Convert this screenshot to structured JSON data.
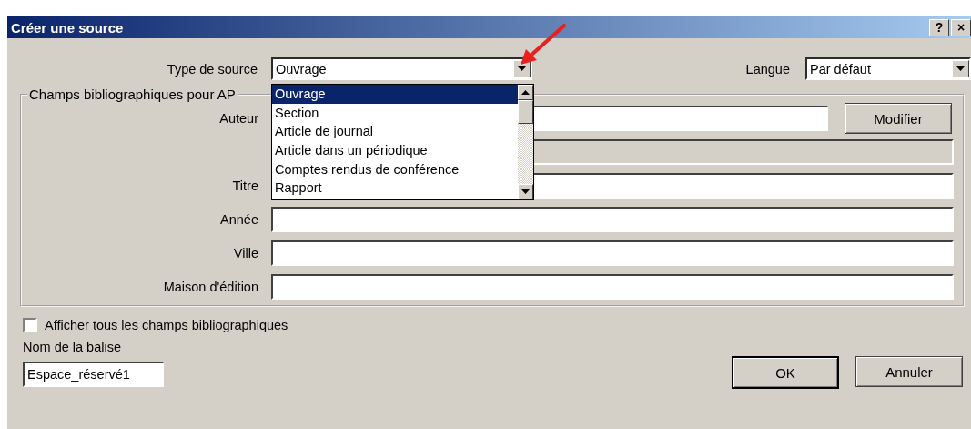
{
  "window": {
    "title": "Créer une source",
    "controls": [
      "?",
      "×"
    ]
  },
  "source_type": {
    "label": "Type de source",
    "value": "Ouvrage",
    "list": {
      "items": [
        {
          "label": "Ouvrage",
          "selected": true
        },
        {
          "label": "Section",
          "selected": false
        },
        {
          "label": "Article de journal",
          "selected": false
        },
        {
          "label": "Article dans un périodique",
          "selected": false
        },
        {
          "label": "Comptes rendus de conférence",
          "selected": false
        },
        {
          "label": "Rapport",
          "selected": false
        }
      ]
    }
  },
  "language": {
    "label": "Langue",
    "value": "Par défaut"
  },
  "group": {
    "label": "Champs bibliographiques pour AP",
    "fields": [
      {
        "label": "Auteur",
        "button": "Modifier",
        "disabled": false
      },
      {
        "disabled": true
      },
      {
        "label": "Titre",
        "disabled": false
      },
      {
        "label": "Année",
        "disabled": false
      },
      {
        "label": "Ville",
        "disabled": false
      },
      {
        "label": "Maison d'édition",
        "disabled": false
      }
    ]
  },
  "show_all": {
    "label": "Afficher tous les champs bibliographiques",
    "checked": false
  },
  "tag_name": {
    "label": "Nom de la balise",
    "value": "Espace_réservé1"
  },
  "buttons": [
    {
      "label": "OK",
      "default": true
    },
    {
      "label": "Annuler",
      "default": false
    }
  ]
}
